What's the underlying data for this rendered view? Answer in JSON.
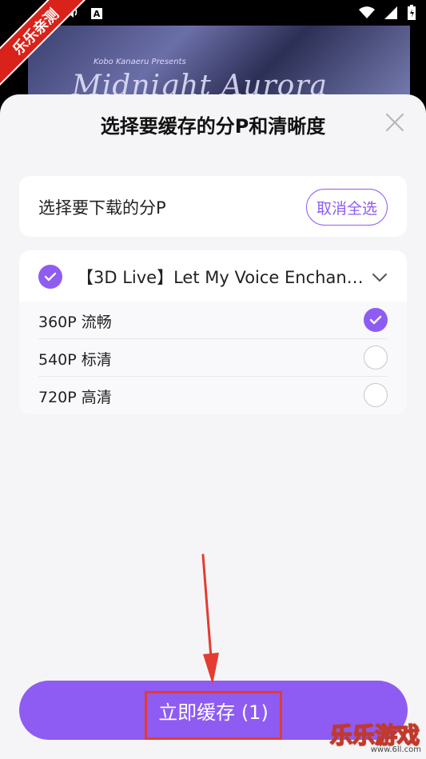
{
  "status_bar": {
    "left_icons": [
      "sound-icon",
      "a-badge-icon"
    ],
    "right_icons": [
      "wifi-icon",
      "signal-icon",
      "battery-icon"
    ],
    "a_badge": "A"
  },
  "banner": {
    "presents": "Kobo Kanaeru Presents",
    "art_title": "Midnight Aurora"
  },
  "watermark": {
    "ribbon": "乐乐亲测",
    "logo": "乐乐游戏",
    "logo_sub": "www.6ll.com"
  },
  "sheet": {
    "title": "选择要缓存的分P和清晰度",
    "select_card": {
      "label": "选择要下载的分P",
      "deselect_all": "取消全选"
    },
    "video": {
      "title": "【3D Live】Let My Voice Enchanting…",
      "checked": true
    },
    "resolutions": [
      {
        "label": "360P 流畅",
        "checked": true
      },
      {
        "label": "540P 标清",
        "checked": false
      },
      {
        "label": "720P 高清",
        "checked": false
      }
    ],
    "cache_button": "立即缓存 (1)"
  },
  "colors": {
    "accent": "#8e5cf2",
    "sheet_bg": "#f5f5f7",
    "card_bg": "#ffffff",
    "annotation": "#e43b32"
  }
}
